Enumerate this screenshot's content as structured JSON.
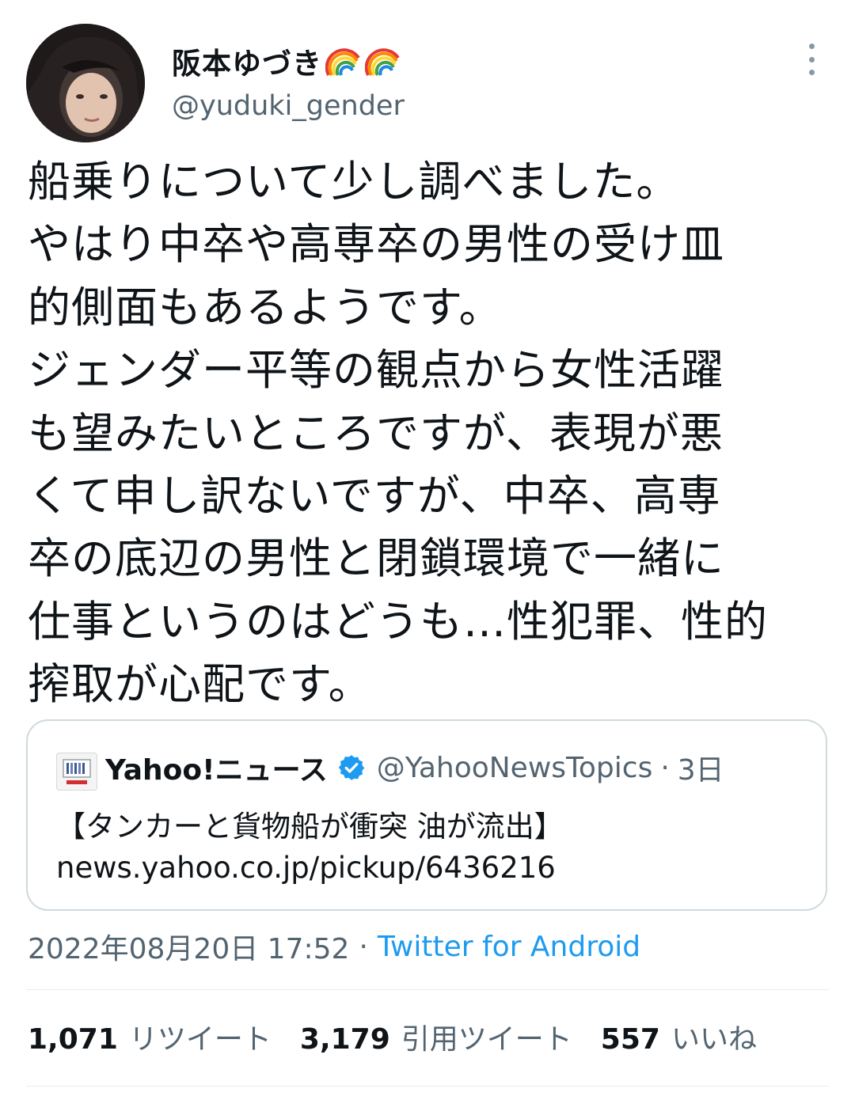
{
  "tweet": {
    "display_name": "阪本ゆづき",
    "handle": "@yuduki_gender",
    "text": "船乗りについて少し調べました。\nやはり中卒や高専卒の男性の受け皿\n的側面もあるようです。\nジェンダー平等の観点から女性活躍\nも望みたいところですが、表現が悪\nくて申し訳ないですが、中卒、高専\n卒の底辺の男性と閉鎖環境で一緒に\n仕事というのはどうも…性犯罪、性的\n搾取が心配です。",
    "timestamp": "2022年08月20日 17:52",
    "separator": "·",
    "source": "Twitter for Android"
  },
  "quoted": {
    "name": "Yahoo!ニュース",
    "handle": "@YahooNewsTopics",
    "separator": "·",
    "time": "3日",
    "title": "【タンカーと貨物船が衝突 油が流出】",
    "url": "news.yahoo.co.jp/pickup/6436216"
  },
  "stats": [
    {
      "count": "1,071",
      "label": "リツイート"
    },
    {
      "count": "3,179",
      "label": "引用ツイート"
    },
    {
      "count": "557",
      "label": "いいね"
    }
  ],
  "icons": {
    "more": "more-vertical-icon",
    "rainbow": "rainbow-emoji-icon",
    "verified": "verified-badge-icon"
  },
  "colors": {
    "link": "#1d9bf0",
    "secondary_text": "#536471",
    "border": "#cfd9de",
    "verified": "#1d9bf0"
  }
}
